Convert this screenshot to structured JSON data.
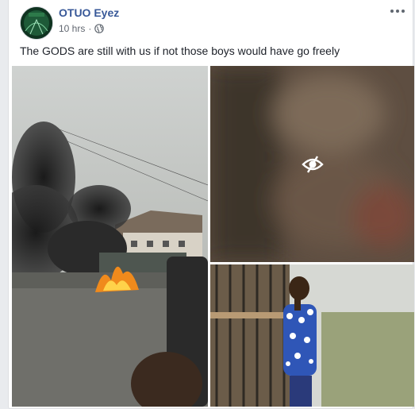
{
  "post": {
    "page_name": "OTUO Eyez",
    "avatar_text": "OTUO Eyez",
    "time": "10 hrs",
    "separator": "·",
    "privacy_icon": "globe-icon",
    "menu_icon": "more-options-icon",
    "caption": "The GODS are still with us if not those boys would have go freely"
  },
  "photos": [
    {
      "name": "fire-scene-photo"
    },
    {
      "name": "blurred-hidden-photo",
      "overlay_icon": "eye-slash-icon"
    },
    {
      "name": "girl-portrait-photo"
    }
  ],
  "colors": {
    "link": "#385898",
    "text": "#1d2129",
    "meta": "#616770",
    "background": "#e9ebee"
  }
}
